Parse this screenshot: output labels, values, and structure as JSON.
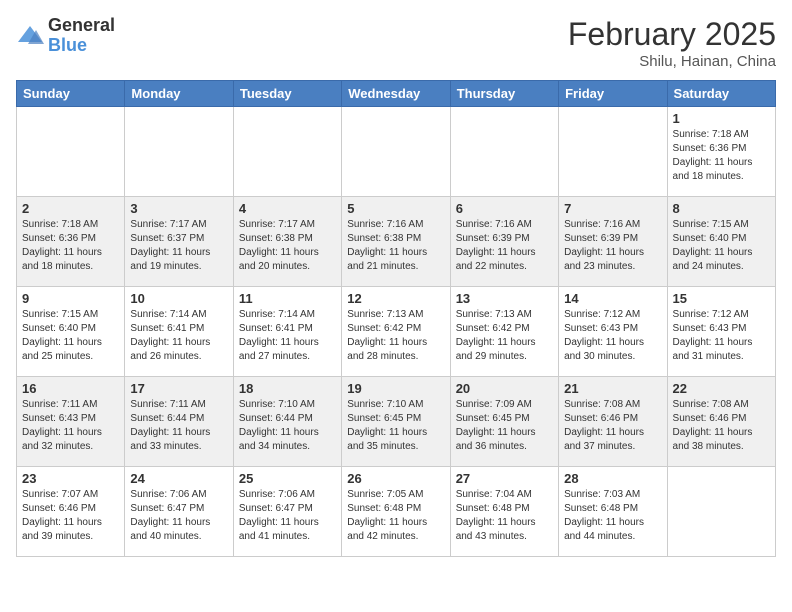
{
  "logo": {
    "general": "General",
    "blue": "Blue"
  },
  "header": {
    "month": "February 2025",
    "location": "Shilu, Hainan, China"
  },
  "weekdays": [
    "Sunday",
    "Monday",
    "Tuesday",
    "Wednesday",
    "Thursday",
    "Friday",
    "Saturday"
  ],
  "weeks": [
    [
      {
        "day": "",
        "info": ""
      },
      {
        "day": "",
        "info": ""
      },
      {
        "day": "",
        "info": ""
      },
      {
        "day": "",
        "info": ""
      },
      {
        "day": "",
        "info": ""
      },
      {
        "day": "",
        "info": ""
      },
      {
        "day": "1",
        "info": "Sunrise: 7:18 AM\nSunset: 6:36 PM\nDaylight: 11 hours\nand 18 minutes."
      }
    ],
    [
      {
        "day": "2",
        "info": "Sunrise: 7:18 AM\nSunset: 6:36 PM\nDaylight: 11 hours\nand 18 minutes."
      },
      {
        "day": "3",
        "info": "Sunrise: 7:17 AM\nSunset: 6:37 PM\nDaylight: 11 hours\nand 19 minutes."
      },
      {
        "day": "4",
        "info": "Sunrise: 7:17 AM\nSunset: 6:38 PM\nDaylight: 11 hours\nand 20 minutes."
      },
      {
        "day": "5",
        "info": "Sunrise: 7:16 AM\nSunset: 6:38 PM\nDaylight: 11 hours\nand 21 minutes."
      },
      {
        "day": "6",
        "info": "Sunrise: 7:16 AM\nSunset: 6:39 PM\nDaylight: 11 hours\nand 22 minutes."
      },
      {
        "day": "7",
        "info": "Sunrise: 7:16 AM\nSunset: 6:39 PM\nDaylight: 11 hours\nand 23 minutes."
      },
      {
        "day": "8",
        "info": "Sunrise: 7:15 AM\nSunset: 6:40 PM\nDaylight: 11 hours\nand 24 minutes."
      }
    ],
    [
      {
        "day": "9",
        "info": "Sunrise: 7:15 AM\nSunset: 6:40 PM\nDaylight: 11 hours\nand 25 minutes."
      },
      {
        "day": "10",
        "info": "Sunrise: 7:14 AM\nSunset: 6:41 PM\nDaylight: 11 hours\nand 26 minutes."
      },
      {
        "day": "11",
        "info": "Sunrise: 7:14 AM\nSunset: 6:41 PM\nDaylight: 11 hours\nand 27 minutes."
      },
      {
        "day": "12",
        "info": "Sunrise: 7:13 AM\nSunset: 6:42 PM\nDaylight: 11 hours\nand 28 minutes."
      },
      {
        "day": "13",
        "info": "Sunrise: 7:13 AM\nSunset: 6:42 PM\nDaylight: 11 hours\nand 29 minutes."
      },
      {
        "day": "14",
        "info": "Sunrise: 7:12 AM\nSunset: 6:43 PM\nDaylight: 11 hours\nand 30 minutes."
      },
      {
        "day": "15",
        "info": "Sunrise: 7:12 AM\nSunset: 6:43 PM\nDaylight: 11 hours\nand 31 minutes."
      }
    ],
    [
      {
        "day": "16",
        "info": "Sunrise: 7:11 AM\nSunset: 6:43 PM\nDaylight: 11 hours\nand 32 minutes."
      },
      {
        "day": "17",
        "info": "Sunrise: 7:11 AM\nSunset: 6:44 PM\nDaylight: 11 hours\nand 33 minutes."
      },
      {
        "day": "18",
        "info": "Sunrise: 7:10 AM\nSunset: 6:44 PM\nDaylight: 11 hours\nand 34 minutes."
      },
      {
        "day": "19",
        "info": "Sunrise: 7:10 AM\nSunset: 6:45 PM\nDaylight: 11 hours\nand 35 minutes."
      },
      {
        "day": "20",
        "info": "Sunrise: 7:09 AM\nSunset: 6:45 PM\nDaylight: 11 hours\nand 36 minutes."
      },
      {
        "day": "21",
        "info": "Sunrise: 7:08 AM\nSunset: 6:46 PM\nDaylight: 11 hours\nand 37 minutes."
      },
      {
        "day": "22",
        "info": "Sunrise: 7:08 AM\nSunset: 6:46 PM\nDaylight: 11 hours\nand 38 minutes."
      }
    ],
    [
      {
        "day": "23",
        "info": "Sunrise: 7:07 AM\nSunset: 6:46 PM\nDaylight: 11 hours\nand 39 minutes."
      },
      {
        "day": "24",
        "info": "Sunrise: 7:06 AM\nSunset: 6:47 PM\nDaylight: 11 hours\nand 40 minutes."
      },
      {
        "day": "25",
        "info": "Sunrise: 7:06 AM\nSunset: 6:47 PM\nDaylight: 11 hours\nand 41 minutes."
      },
      {
        "day": "26",
        "info": "Sunrise: 7:05 AM\nSunset: 6:48 PM\nDaylight: 11 hours\nand 42 minutes."
      },
      {
        "day": "27",
        "info": "Sunrise: 7:04 AM\nSunset: 6:48 PM\nDaylight: 11 hours\nand 43 minutes."
      },
      {
        "day": "28",
        "info": "Sunrise: 7:03 AM\nSunset: 6:48 PM\nDaylight: 11 hours\nand 44 minutes."
      },
      {
        "day": "",
        "info": ""
      }
    ]
  ]
}
